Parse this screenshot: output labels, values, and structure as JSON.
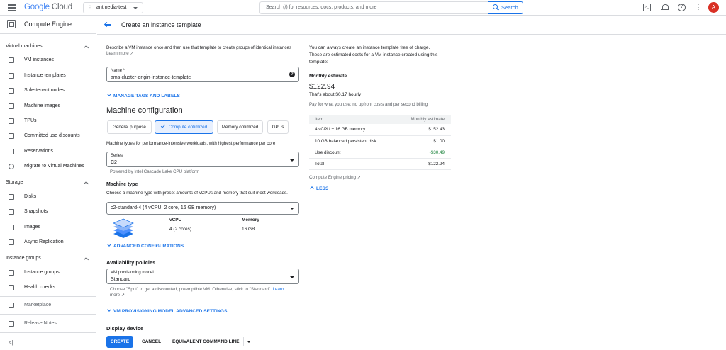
{
  "topbar": {
    "logo_google": "Google",
    "logo_cloud": " Cloud",
    "project": "antmedia-test",
    "search_placeholder": "Search (/) for resources, docs, products, and more",
    "search_button": "Search",
    "avatar_letter": "A",
    "avatar_color": "#d93025"
  },
  "sidebar": {
    "product_title": "Compute Engine",
    "sections": [
      {
        "label": "Virtual machines",
        "items": [
          "VM instances",
          "Instance templates",
          "Sole-tenant nodes",
          "Machine images",
          "TPUs",
          "Committed use discounts",
          "Reservations",
          "Migrate to Virtual Machines"
        ]
      },
      {
        "label": "Storage",
        "items": [
          "Disks",
          "Snapshots",
          "Images",
          "Async Replication"
        ]
      },
      {
        "label": "Instance groups",
        "items": [
          "Instance groups",
          "Health checks"
        ]
      }
    ],
    "bottom_items": [
      "Marketplace",
      "Release Notes"
    ],
    "collapse_glyph": "<|"
  },
  "header": {
    "title": "Create an instance template"
  },
  "form": {
    "intro": "Describe a VM instance once and then use that template to create groups of identical instances",
    "learn_more": "Learn more",
    "name_label": "Name *",
    "name_value": "ams-cluster-origin-instance-template",
    "manage_tags": "MANAGE TAGS AND LABELS",
    "machine_config_title": "Machine configuration",
    "families": [
      "General purpose",
      "Compute optimized",
      "Memory optimized",
      "GPUs"
    ],
    "selected_family": "Compute optimized",
    "family_desc": "Machine types for performance-intensive workloads, with highest performance per core",
    "series_label": "Series",
    "series_value": "C2",
    "series_hint": "Powered by Intel Cascade Lake CPU platform",
    "machine_type_title": "Machine type",
    "machine_type_desc": "Choose a machine type with preset amounts of vCPUs and memory that suit most workloads.",
    "machine_type_value": "c2-standard-4 (4 vCPU, 2 core, 16 GB memory)",
    "vcpu_header": "vCPU",
    "vcpu_value": "4 (2 cores)",
    "memory_header": "Memory",
    "memory_value": "16 GB",
    "advanced_config": "ADVANCED CONFIGURATIONS",
    "availability_title": "Availability policies",
    "provisioning_label": "VM provisioning model",
    "provisioning_value": "Standard",
    "provisioning_hint_1": "Choose \"Spot\" to get a discounted, preemptible VM. Otherwise, stick to \"Standard\".",
    "provisioning_learn_1": "Learn",
    "provisioning_learn_2": "more",
    "provisioning_advanced": "VM PROVISIONING MODEL ADVANCED SETTINGS",
    "display_device_title": "Display device"
  },
  "estimate": {
    "note_1": "You can always create an instance template free of charge.",
    "note_2": "These are estimated costs for a VM instance created using this",
    "note_3": "template:",
    "monthly_label": "Monthly estimate",
    "monthly_value": "$122.94",
    "hourly": "That's about $0.17 hourly",
    "billing_note": "Pay for what you use: no upfront costs and per second billing",
    "col_item": "Item",
    "col_monthly": "Monthly estimate",
    "rows": [
      {
        "item": "4 vCPU + 16 GB memory",
        "cost": "$152.43"
      },
      {
        "item": "10 GB balanced persistent disk",
        "cost": "$1.00"
      },
      {
        "item": "Use discount",
        "cost": "-$30.49"
      },
      {
        "item": "Total",
        "cost": "$122.94"
      }
    ],
    "pricing_link": "Compute Engine pricing",
    "less": "LESS"
  },
  "footer": {
    "create": "CREATE",
    "cancel": "CANCEL",
    "cmdline": "EQUIVALENT COMMAND LINE"
  }
}
